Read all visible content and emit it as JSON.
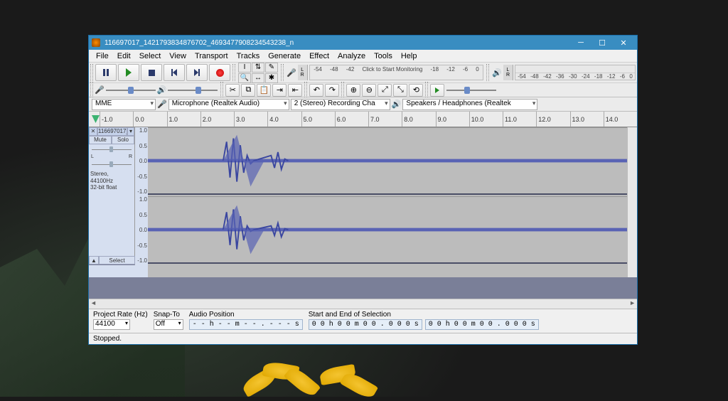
{
  "window": {
    "title": "116697017_1421793834876702_4693477908234543238_n"
  },
  "menu": [
    "File",
    "Edit",
    "Select",
    "View",
    "Transport",
    "Tracks",
    "Generate",
    "Effect",
    "Analyze",
    "Tools",
    "Help"
  ],
  "meters": {
    "monitor_hint": "Click to Start Monitoring",
    "ticks_top": [
      "-54",
      "-48",
      "-42",
      "Click to Start Monitoring",
      "-18",
      "-12",
      "-6",
      "0"
    ],
    "ticks_bot": [
      "-54",
      "-48",
      "-42",
      "-36",
      "-30",
      "-24",
      "-18",
      "-12",
      "-6",
      "0"
    ]
  },
  "devices": {
    "host": "MME",
    "input": "Microphone (Realtek Audio)",
    "channels": "2 (Stereo) Recording Cha",
    "output": "Speakers / Headphones (Realtek"
  },
  "ruler": [
    "-1.0",
    "0.0",
    "1.0",
    "2.0",
    "3.0",
    "4.0",
    "5.0",
    "6.0",
    "7.0",
    "8.0",
    "9.0",
    "10.0",
    "11.0",
    "12.0",
    "13.0",
    "14.0"
  ],
  "track": {
    "name": "116697017_",
    "mute": "Mute",
    "solo": "Solo",
    "pan_l": "L",
    "pan_r": "R",
    "info1": "Stereo, 44100Hz",
    "info2": "32-bit float",
    "select_btn": "Select",
    "collapse_btn": "▲",
    "axis": [
      "1.0",
      "0.5",
      "0.0",
      "-0.5",
      "-1.0"
    ]
  },
  "selection_bar": {
    "project_rate_label": "Project Rate (Hz)",
    "project_rate": "44100",
    "snap_label": "Snap-To",
    "snap": "Off",
    "audio_pos_label": "Audio Position",
    "audio_pos": "- - h - - m - - . - - - s",
    "sel_label": "Start and End of Selection",
    "sel_start": "0 0 h 0 0 m 0 0 . 0 0 0 s",
    "sel_end": "0 0 h 0 0 m 0 0 . 0 0 0 s"
  },
  "status": "Stopped."
}
